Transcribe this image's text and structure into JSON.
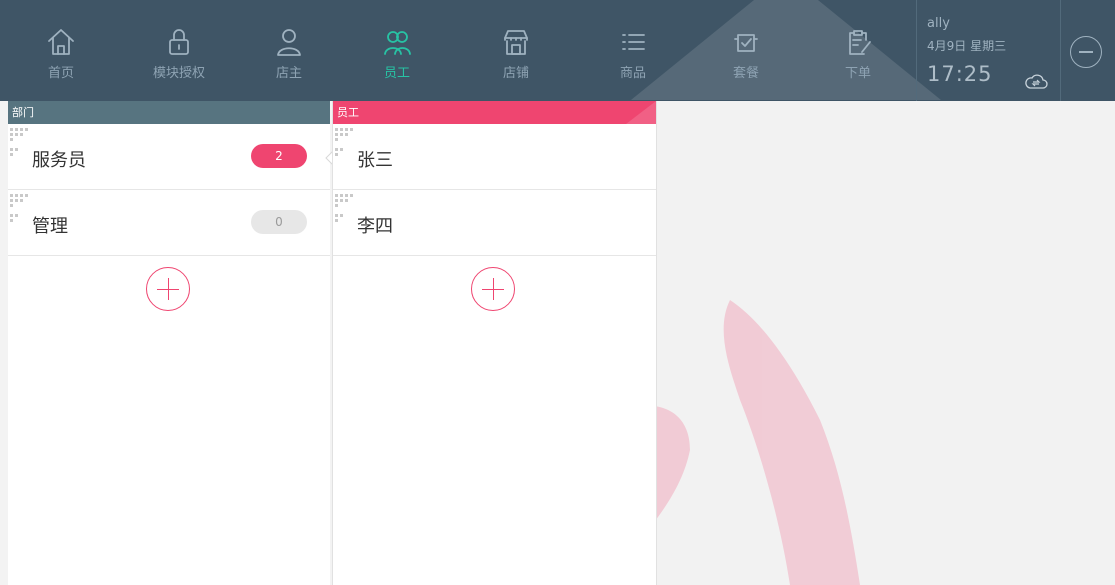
{
  "nav": {
    "items": [
      {
        "label": "首页",
        "icon": "home-icon"
      },
      {
        "label": "模块授权",
        "icon": "lock-icon"
      },
      {
        "label": "店主",
        "icon": "user-icon"
      },
      {
        "label": "员工",
        "icon": "users-icon",
        "active": true
      },
      {
        "label": "店铺",
        "icon": "store-icon"
      },
      {
        "label": "商品",
        "icon": "list-icon"
      },
      {
        "label": "套餐",
        "icon": "package-icon"
      },
      {
        "label": "下单",
        "icon": "clipboard-icon"
      }
    ],
    "active_color": "#27c3a4"
  },
  "user": {
    "name": "ally",
    "date": "4月9日 星期三",
    "time": "17:25"
  },
  "departments": {
    "header": "部门",
    "items": [
      {
        "label": "服务员",
        "count": "2"
      },
      {
        "label": "管理",
        "count": "0"
      }
    ]
  },
  "staff": {
    "header": "员工",
    "items": [
      {
        "label": "张三"
      },
      {
        "label": "李四"
      }
    ]
  },
  "colors": {
    "topbar": "#3f5566",
    "accent": "#ef4570",
    "dept_header": "#577480"
  }
}
